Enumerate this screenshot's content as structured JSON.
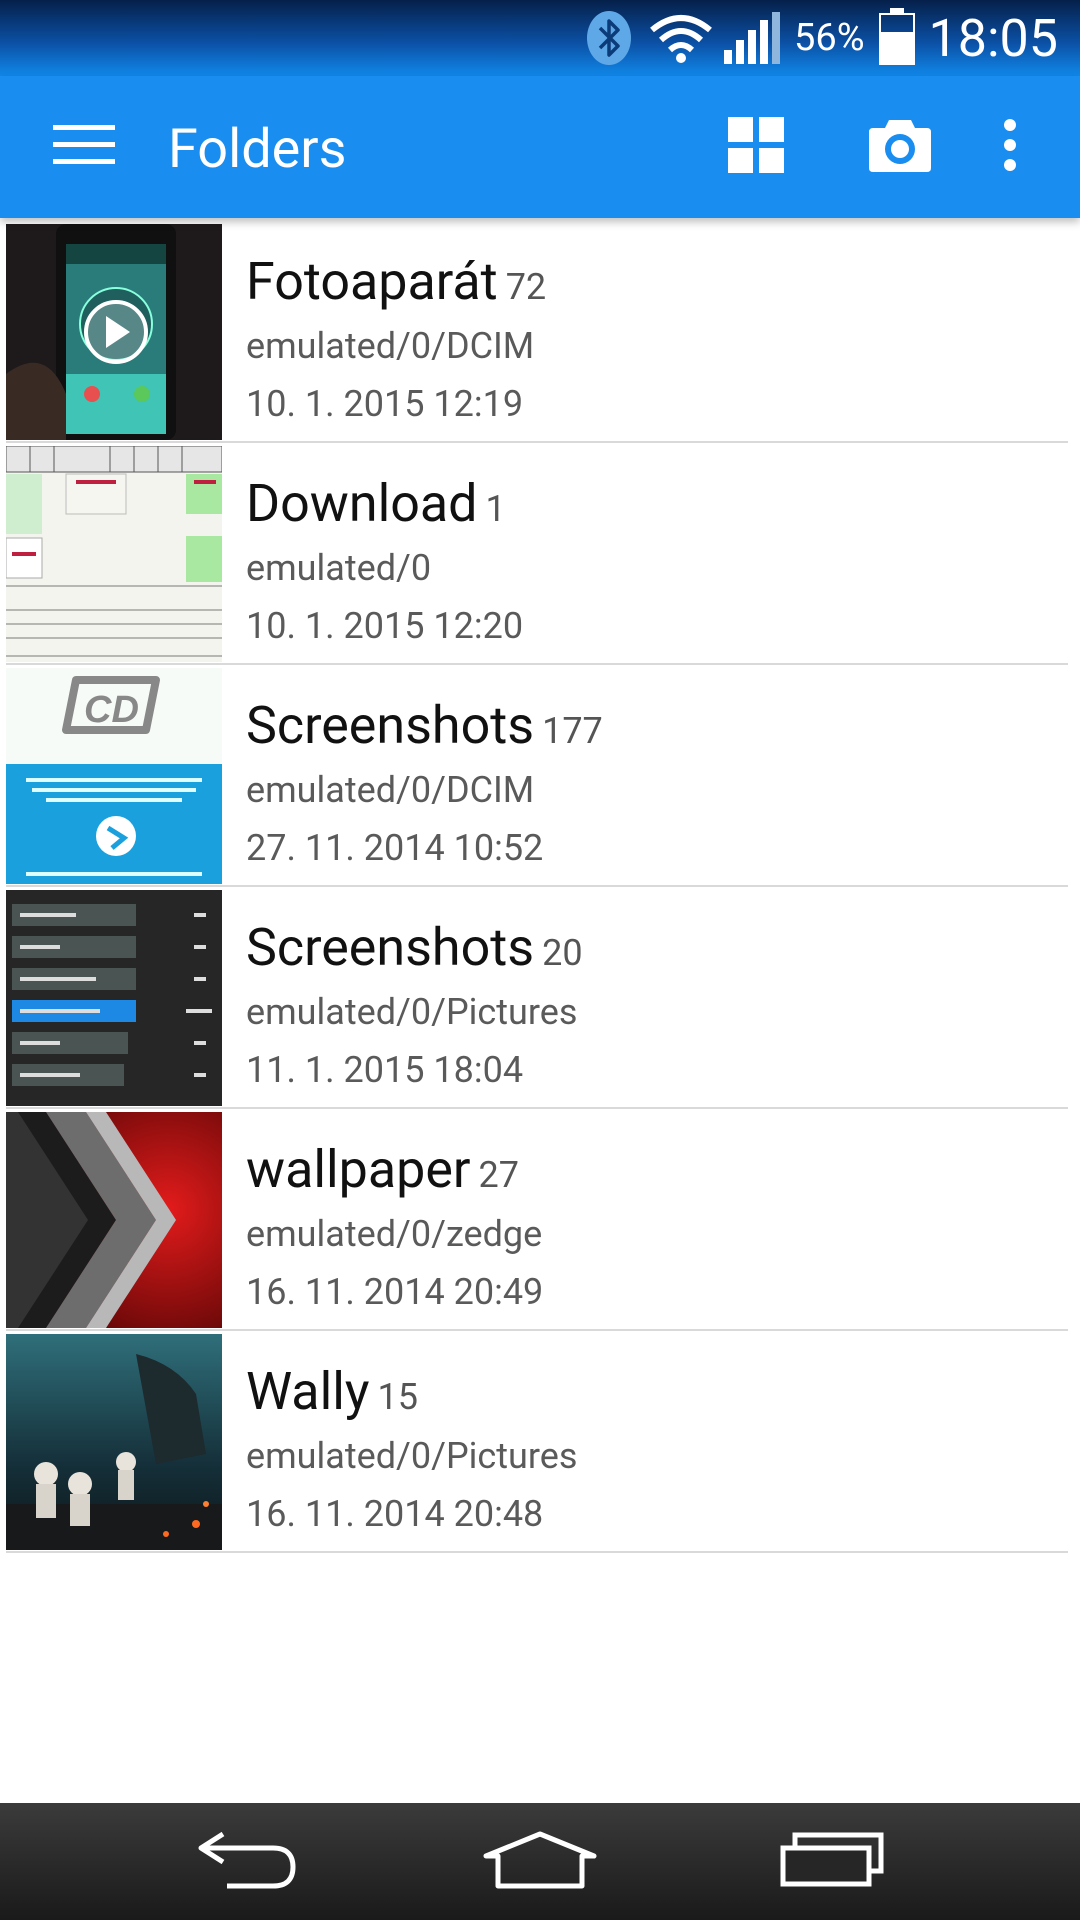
{
  "status_bar": {
    "battery_percent": "56%",
    "time": "18:05",
    "icons": [
      "bluetooth-icon",
      "wifi-icon",
      "signal-icon",
      "battery-icon"
    ]
  },
  "app_bar": {
    "title": "Folders",
    "actions": [
      "menu-icon",
      "grid-view-icon",
      "camera-icon",
      "overflow-menu-icon"
    ]
  },
  "folders": [
    {
      "name": "Fotoaparát",
      "count": "72",
      "path": "emulated/0/DCIM",
      "date": "10. 1. 2015 12:19"
    },
    {
      "name": "Download",
      "count": "1",
      "path": "emulated/0",
      "date": "10. 1. 2015 12:20"
    },
    {
      "name": "Screenshots",
      "count": "177",
      "path": "emulated/0/DCIM",
      "date": "27. 11. 2014 10:52"
    },
    {
      "name": "Screenshots",
      "count": "20",
      "path": "emulated/0/Pictures",
      "date": "11. 1. 2015 18:04"
    },
    {
      "name": "wallpaper",
      "count": "27",
      "path": "emulated/0/zedge",
      "date": "16. 11. 2014 20:49"
    },
    {
      "name": "Wally",
      "count": "15",
      "path": "emulated/0/Pictures",
      "date": "16. 11. 2014 20:48"
    }
  ],
  "nav_bar": [
    "back-icon",
    "home-icon",
    "recents-icon"
  ],
  "colors": {
    "app_bar": "#1a8df0",
    "divider": "#d9d9d9"
  }
}
